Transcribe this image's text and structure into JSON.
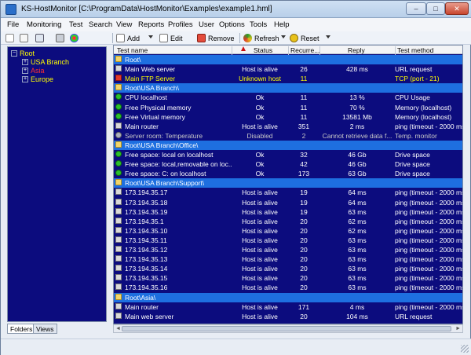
{
  "window": {
    "app_name": "KS-HostMonitor",
    "path": "[C:\\ProgramData\\HostMonitor\\Examples\\example1.hml]",
    "controls": {
      "minimize": "–",
      "maximize": "□",
      "close": "✕"
    }
  },
  "menu": [
    "File",
    "Monitoring",
    "Test",
    "Search",
    "View",
    "Reports",
    "Profiles",
    "User",
    "Options",
    "Tools",
    "Help"
  ],
  "toolbar": {
    "add_label": "Add",
    "edit_label": "Edit",
    "remove_label": "Remove",
    "refresh_label": "Refresh",
    "reset_label": "Reset"
  },
  "tree": {
    "root": "Root",
    "usa_branch": "USA Branch",
    "asia": "Asia",
    "europe": "Europe"
  },
  "tabs": {
    "folders": "Folders",
    "views": "Views"
  },
  "grid": {
    "columns": {
      "name": "Test name",
      "status": "Status",
      "recurrences": "Recurre...",
      "reply": "Reply",
      "method": "Test method"
    },
    "rows": [
      {
        "type": "folder",
        "name": "Root\\"
      },
      {
        "type": "test",
        "icon": "server",
        "name": "Main Web server",
        "status": "Host is alive",
        "rec": "26",
        "reply": "428 ms",
        "method": "URL request",
        "color": "#ffffff"
      },
      {
        "type": "test",
        "icon": "red",
        "name": "Main FTP Server",
        "status": "Unknown host",
        "rec": "11",
        "reply": "",
        "method": "TCP (port - 21)",
        "color": "#ffff00"
      },
      {
        "type": "folder",
        "name": "Root\\USA Branch\\"
      },
      {
        "type": "test",
        "icon": "green",
        "name": "CPU localhost",
        "status": "Ok",
        "rec": "11",
        "reply": "13 %",
        "method": "CPU Usage",
        "color": "#ffffff"
      },
      {
        "type": "test",
        "icon": "green",
        "name": "Free Physical memory",
        "status": "Ok",
        "rec": "11",
        "reply": "70 %",
        "method": "Memory (localhost)",
        "color": "#ffffff"
      },
      {
        "type": "test",
        "icon": "green",
        "name": "Free Virtual memory",
        "status": "Ok",
        "rec": "11",
        "reply": "13581 Mb",
        "method": "Memory (localhost)",
        "color": "#ffffff"
      },
      {
        "type": "test",
        "icon": "server",
        "name": "Main router",
        "status": "Host is alive",
        "rec": "351",
        "reply": "2 ms",
        "method": "ping (timeout - 2000 ms)",
        "color": "#ffffff"
      },
      {
        "type": "test",
        "icon": "grey",
        "name": "Server room: Temperature",
        "status": "Disabled",
        "rec": "2",
        "reply": "Cannot retrieve data f...",
        "method": "Temp. monitor",
        "color": "#c8c8c8"
      },
      {
        "type": "folder",
        "name": "Root\\USA Branch\\Office\\"
      },
      {
        "type": "test",
        "icon": "green",
        "name": "Free space: local on localhost",
        "status": "Ok",
        "rec": "32",
        "reply": "46 Gb",
        "method": "Drive space",
        "color": "#ffffff"
      },
      {
        "type": "test",
        "icon": "green",
        "name": "Free space: local,removable on loc...",
        "status": "Ok",
        "rec": "42",
        "reply": "46 Gb",
        "method": "Drive space",
        "color": "#ffffff"
      },
      {
        "type": "test",
        "icon": "green",
        "name": "Free space: C: on localhost",
        "status": "Ok",
        "rec": "173",
        "reply": "63 Gb",
        "method": "Drive space",
        "color": "#ffffff"
      },
      {
        "type": "folder",
        "name": "Root\\USA Branch\\Support\\"
      },
      {
        "type": "test",
        "icon": "server",
        "name": "173.194.35.17",
        "status": "Host is alive",
        "rec": "19",
        "reply": "64 ms",
        "method": "ping (timeout - 2000 ms)",
        "color": "#ffffff"
      },
      {
        "type": "test",
        "icon": "server",
        "name": "173.194.35.18",
        "status": "Host is alive",
        "rec": "19",
        "reply": "64 ms",
        "method": "ping (timeout - 2000 ms)",
        "color": "#ffffff"
      },
      {
        "type": "test",
        "icon": "server",
        "name": "173.194.35.19",
        "status": "Host is alive",
        "rec": "19",
        "reply": "63 ms",
        "method": "ping (timeout - 2000 ms)",
        "color": "#ffffff"
      },
      {
        "type": "test",
        "icon": "server",
        "name": "173.194.35.1",
        "status": "Host is alive",
        "rec": "20",
        "reply": "62 ms",
        "method": "ping (timeout - 2000 ms)",
        "color": "#ffffff"
      },
      {
        "type": "test",
        "icon": "server",
        "name": "173.194.35.10",
        "status": "Host is alive",
        "rec": "20",
        "reply": "62 ms",
        "method": "ping (timeout - 2000 ms)",
        "color": "#ffffff"
      },
      {
        "type": "test",
        "icon": "server",
        "name": "173.194.35.11",
        "status": "Host is alive",
        "rec": "20",
        "reply": "63 ms",
        "method": "ping (timeout - 2000 ms)",
        "color": "#ffffff"
      },
      {
        "type": "test",
        "icon": "server",
        "name": "173.194.35.12",
        "status": "Host is alive",
        "rec": "20",
        "reply": "63 ms",
        "method": "ping (timeout - 2000 ms)",
        "color": "#ffffff"
      },
      {
        "type": "test",
        "icon": "server",
        "name": "173.194.35.13",
        "status": "Host is alive",
        "rec": "20",
        "reply": "63 ms",
        "method": "ping (timeout - 2000 ms)",
        "color": "#ffffff"
      },
      {
        "type": "test",
        "icon": "server",
        "name": "173.194.35.14",
        "status": "Host is alive",
        "rec": "20",
        "reply": "63 ms",
        "method": "ping (timeout - 2000 ms)",
        "color": "#ffffff"
      },
      {
        "type": "test",
        "icon": "server",
        "name": "173.194.35.15",
        "status": "Host is alive",
        "rec": "20",
        "reply": "63 ms",
        "method": "ping (timeout - 2000 ms)",
        "color": "#ffffff"
      },
      {
        "type": "test",
        "icon": "server",
        "name": "173.194.35.16",
        "status": "Host is alive",
        "rec": "20",
        "reply": "63 ms",
        "method": "ping (timeout - 2000 ms)",
        "color": "#ffffff"
      },
      {
        "type": "folder",
        "name": "Root\\Asia\\"
      },
      {
        "type": "test",
        "icon": "server",
        "name": "Main router",
        "status": "Host is alive",
        "rec": "171",
        "reply": "4 ms",
        "method": "ping (timeout - 2000 ms)",
        "color": "#ffffff"
      },
      {
        "type": "test",
        "icon": "server",
        "name": "Main web server",
        "status": "Host is alive",
        "rec": "20",
        "reply": "104 ms",
        "method": "URL request",
        "color": "#ffffff"
      }
    ]
  },
  "colors": {
    "grid_bg": "#0c0c7e",
    "folder_row": "#1e6fe0",
    "tree_text": "#ffff00",
    "asia_text": "#ff3030"
  }
}
